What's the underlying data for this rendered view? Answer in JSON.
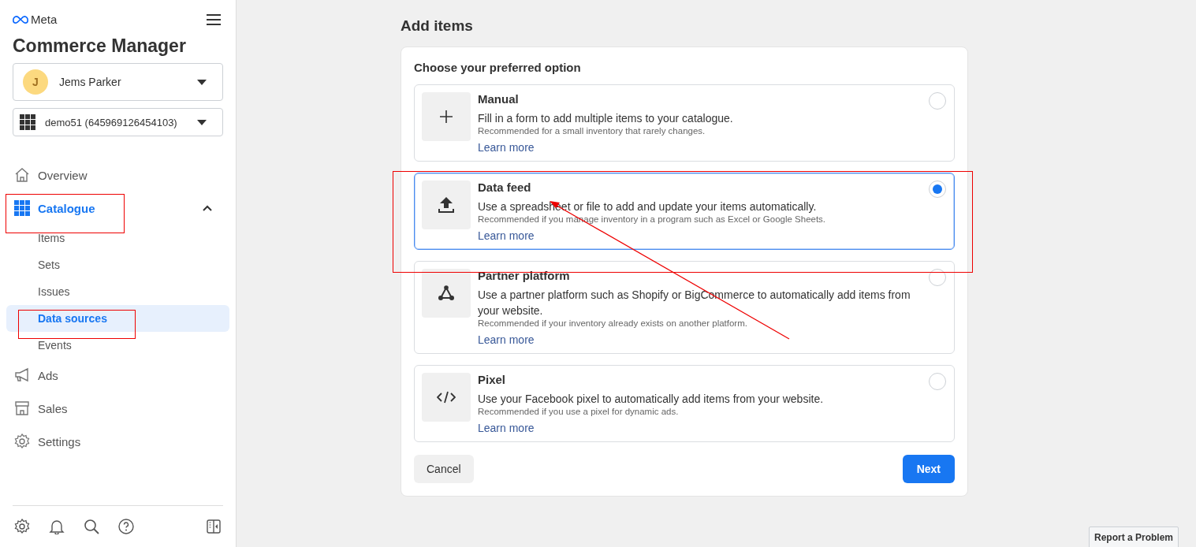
{
  "sidebar": {
    "brand": "Meta",
    "title": "Commerce Manager",
    "account": {
      "initial": "J",
      "name": "Jems Parker"
    },
    "business": {
      "name": "demo51 (645969126454103)"
    },
    "nav": [
      {
        "label": "Overview",
        "selected": false
      },
      {
        "label": "Catalogue",
        "selected": true,
        "expanded": true,
        "children": [
          {
            "label": "Items",
            "selected": false
          },
          {
            "label": "Sets",
            "selected": false
          },
          {
            "label": "Issues",
            "selected": false
          },
          {
            "label": "Data sources",
            "selected": true
          },
          {
            "label": "Events",
            "selected": false
          }
        ]
      },
      {
        "label": "Ads",
        "selected": false
      },
      {
        "label": "Sales",
        "selected": false
      },
      {
        "label": "Settings",
        "selected": false
      }
    ]
  },
  "page": {
    "title": "Add items",
    "card_heading": "Choose your preferred option",
    "options": [
      {
        "title": "Manual",
        "description": "Fill in a form to add multiple items to your catalogue.",
        "note": "Recommended for a small inventory that rarely changes.",
        "link": "Learn more",
        "selected": false
      },
      {
        "title": "Data feed",
        "description": "Use a spreadsheet or file to add and update your items automatically.",
        "note": "Recommended if you manage inventory in a program such as Excel or Google Sheets.",
        "link": "Learn more",
        "selected": true
      },
      {
        "title": "Partner platform",
        "description": "Use a partner platform such as Shopify or BigCommerce to automatically add items from your website.",
        "note": "Recommended if your inventory already exists on another platform.",
        "link": "Learn more",
        "selected": false
      },
      {
        "title": "Pixel",
        "description": "Use your Facebook pixel to automatically add items from your website.",
        "note": "Recommended if you use a pixel for dynamic ads.",
        "link": "Learn more",
        "selected": false
      }
    ],
    "cancel": "Cancel",
    "next": "Next"
  },
  "report_button": "Report a Problem"
}
